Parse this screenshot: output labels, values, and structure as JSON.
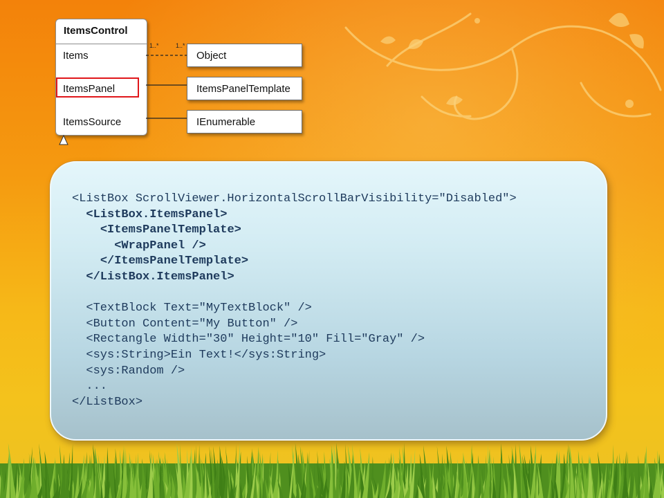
{
  "diagram": {
    "class_name": "ItemsControl",
    "properties": [
      "Items",
      "ItemsPanel",
      "ItemsSource"
    ],
    "selected_property": "ItemsPanel",
    "targets": [
      "Object",
      "ItemsPanelTemplate",
      "IEnumerable"
    ],
    "multiplicity_source": "1..*",
    "multiplicity_target": "1..*"
  },
  "code_lines": [
    {
      "indent": "",
      "text": "<ListBox ScrollViewer.HorizontalScrollBarVisibility=\"Disabled\">",
      "bold": false
    },
    {
      "indent": "  ",
      "text": "<ListBox.ItemsPanel>",
      "bold": true
    },
    {
      "indent": "    ",
      "text": "<ItemsPanelTemplate>",
      "bold": true
    },
    {
      "indent": "      ",
      "text": "<WrapPanel />",
      "bold": true
    },
    {
      "indent": "    ",
      "text": "</ItemsPanelTemplate>",
      "bold": true
    },
    {
      "indent": "  ",
      "text": "</ListBox.ItemsPanel>",
      "bold": true
    },
    {
      "indent": "",
      "text": "",
      "bold": false
    },
    {
      "indent": "  ",
      "text": "<TextBlock Text=\"MyTextBlock\" />",
      "bold": false
    },
    {
      "indent": "  ",
      "text": "<Button Content=\"My Button\" />",
      "bold": false
    },
    {
      "indent": "  ",
      "text": "<Rectangle Width=\"30\" Height=\"10\" Fill=\"Gray\" />",
      "bold": false
    },
    {
      "indent": "  ",
      "text": "<sys:String>Ein Text!</sys:String>",
      "bold": false
    },
    {
      "indent": "  ",
      "text": "<sys:Random />",
      "bold": false
    },
    {
      "indent": "  ",
      "text": "...",
      "bold": false
    },
    {
      "indent": "",
      "text": "</ListBox>",
      "bold": false
    }
  ],
  "colors": {
    "highlight": "#e0161a",
    "code_text": "#1e3a5c"
  }
}
